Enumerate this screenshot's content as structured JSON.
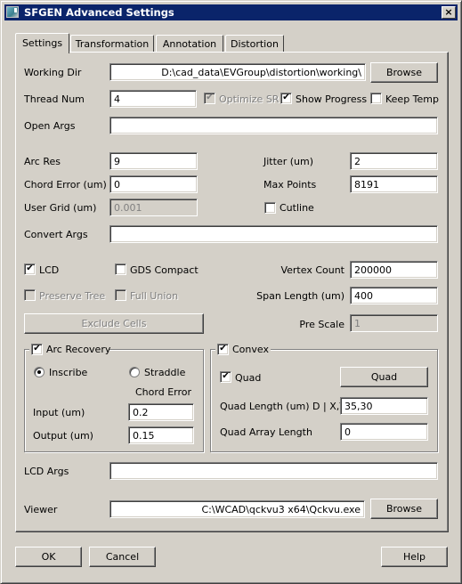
{
  "window": {
    "title": "SFGEN Advanced Settings",
    "close_label": "×"
  },
  "tabs": [
    {
      "label": "Settings",
      "active": true
    },
    {
      "label": "Transformation",
      "active": false
    },
    {
      "label": "Annotation",
      "active": false
    },
    {
      "label": "Distortion",
      "active": false
    }
  ],
  "settings": {
    "working_dir": {
      "label": "Working Dir",
      "value": "D:\\cad_data\\EVGroup\\distortion\\working\\",
      "browse_label": "Browse"
    },
    "thread_num": {
      "label": "Thread Num",
      "value": "4"
    },
    "optimize_sr": {
      "label": "Optimize SR",
      "checked": true,
      "enabled": false
    },
    "show_progress": {
      "label": "Show Progress",
      "checked": true
    },
    "keep_temp": {
      "label": "Keep Temp",
      "checked": false
    },
    "open_args": {
      "label": "Open Args",
      "value": ""
    },
    "arc_res": {
      "label": "Arc Res",
      "value": "9"
    },
    "jitter": {
      "label": "Jitter (um)",
      "value": "2"
    },
    "chord_error": {
      "label": "Chord Error (um)",
      "value": "0"
    },
    "max_points": {
      "label": "Max Points",
      "value": "8191"
    },
    "user_grid": {
      "label": "User Grid (um)",
      "value": "0.001",
      "enabled": false
    },
    "cutline": {
      "label": "Cutline",
      "checked": false
    },
    "convert_args": {
      "label": "Convert Args",
      "value": ""
    },
    "lcd": {
      "label": "LCD",
      "checked": true
    },
    "gds_compact": {
      "label": "GDS Compact",
      "checked": false
    },
    "vertex_count": {
      "label": "Vertex Count",
      "value": "200000"
    },
    "preserve_tree": {
      "label": "Preserve Tree",
      "checked": false,
      "enabled": false
    },
    "full_union": {
      "label": "Full Union",
      "checked": false,
      "enabled": false
    },
    "span_length": {
      "label": "Span Length (um)",
      "value": "400"
    },
    "exclude_cells_label": "Exclude Cells",
    "pre_scale": {
      "label": "Pre Scale",
      "value": "1",
      "enabled": false
    },
    "arc_recovery": {
      "label": "Arc Recovery",
      "checked": true,
      "inscribe_label": "Inscribe",
      "straddle_label": "Straddle",
      "selected": "Inscribe",
      "chord_error_heading": "Chord Error",
      "input": {
        "label": "Input (um)",
        "value": "0.2"
      },
      "output": {
        "label": "Output (um)",
        "value": "0.15"
      }
    },
    "convex": {
      "label": "Convex",
      "checked": true,
      "quad": {
        "label": "Quad",
        "checked": true
      },
      "quad_button_label": "Quad",
      "quad_length": {
        "label": "Quad Length (um) D | X,Y",
        "value": "35,30"
      },
      "quad_array_length": {
        "label": "Quad Array Length",
        "value": "0"
      }
    },
    "lcd_args": {
      "label": "LCD Args",
      "value": ""
    },
    "viewer": {
      "label": "Viewer",
      "value": "C:\\WCAD\\qckvu3 x64\\Qckvu.exe",
      "browse_label": "Browse"
    }
  },
  "footer": {
    "ok_label": "OK",
    "cancel_label": "Cancel",
    "help_label": "Help"
  },
  "check_glyph": "✔"
}
